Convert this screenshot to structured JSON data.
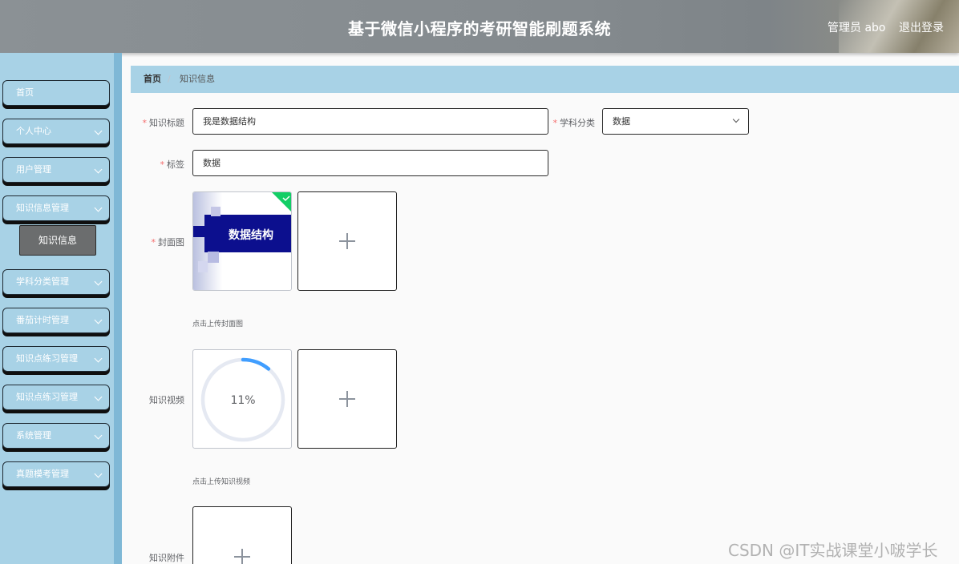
{
  "header": {
    "title": "基于微信小程序的考研智能刷题系统",
    "user": "管理员 abo",
    "logout": "退出登录"
  },
  "sidebar": {
    "items": [
      {
        "label": "首页",
        "has_chevron": false
      },
      {
        "label": "个人中心",
        "has_chevron": true
      },
      {
        "label": "用户管理",
        "has_chevron": true
      },
      {
        "label": "知识信息管理",
        "has_chevron": true
      },
      {
        "label": "学科分类管理",
        "has_chevron": true
      },
      {
        "label": "番茄计时管理",
        "has_chevron": true
      },
      {
        "label": "知识点练习管理",
        "has_chevron": true
      },
      {
        "label": "知识点练习管理",
        "has_chevron": true
      },
      {
        "label": "系统管理",
        "has_chevron": true
      },
      {
        "label": "真题模考管理",
        "has_chevron": true
      }
    ],
    "active_sub": "知识信息"
  },
  "breadcrumb": {
    "home": "首页",
    "separator": "/",
    "current": "知识信息"
  },
  "form": {
    "title_label": "知识标题",
    "title_value": "我是数据结构",
    "category_label": "学科分类",
    "category_value": "数据",
    "tags_label": "标签",
    "tags_value": "数据",
    "cover_label": "封面图",
    "cover_image_text": "数据结构",
    "cover_hint": "点击上传封面图",
    "video_label": "知识视频",
    "video_progress": 11,
    "video_progress_text": "11%",
    "video_hint": "点击上传知识视频",
    "attachment_label": "知识附件"
  },
  "colors": {
    "sidebar_bg": "#a8d2e6",
    "required": "#f56c6c",
    "progress": "#409eff",
    "success": "#13ce66"
  },
  "watermark": "CSDN @IT实战课堂小啵学长"
}
